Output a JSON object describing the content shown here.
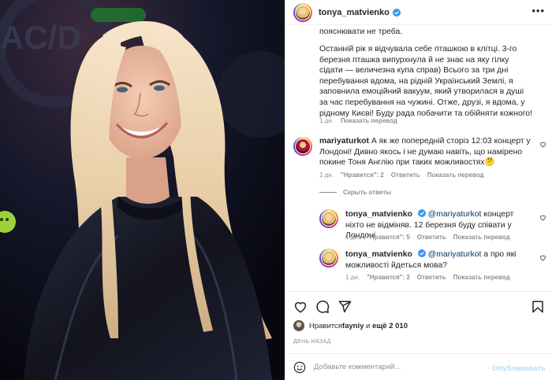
{
  "photo": {
    "alt_icon": "photo-woman-long-blonde-hair"
  },
  "header": {
    "username": "tonya_matvienko",
    "more_icon": "more-dots-icon"
  },
  "caption": {
    "line0": "пояснювати не треба.",
    "paragraph": "Останній рік я відчувала себе пташкою в клітці. 3-го березня пташка випурхнула й не знає на яку гілку сідати — величезна купа справ) Всього за три дні перебування вдома, на рідній Український Землі, я заповнила емоційний вакуум, який утворилася в душі за час перебування на чужині. Отже, друзі, я вдома, у рідному Києві! Буду рада побачити та обійняти кожного!",
    "time": "1 дн.",
    "translate": "Показать перевод"
  },
  "comments": [
    {
      "username": "mariyaturkot",
      "text": "А як же попередній сторіз 12:03 концерт у Лондоні! Дивно якось і не думаю навіть, що намірено покине Тоня Англію при таких можливостях🤔",
      "time": "1 дн.",
      "likes": "\"Нравится\": 2",
      "reply": "Ответить",
      "translate": "Показать перевод"
    }
  ],
  "hide_replies": "Скрыть ответы",
  "replies": [
    {
      "username": "tonya_matvienko",
      "mention": "@mariyaturkot",
      "text": " концерт ніхто не відміняв. 12 березня буду співати у Лондоні",
      "time": "1 дн.",
      "likes": "\"Нравится\": 5",
      "reply": "Ответить",
      "translate": "Показать перевод"
    },
    {
      "username": "tonya_matvienko",
      "mention": "@mariyaturkot",
      "text": " а про які можливості йдеться мова?",
      "time": "1 дн.",
      "likes": "\"Нравится\": 2",
      "reply": "Ответить",
      "translate": "Показать перевод"
    }
  ],
  "actions": {
    "like_icon": "heart-icon",
    "comment_icon": "comment-icon",
    "share_icon": "share-icon",
    "save_icon": "bookmark-icon"
  },
  "likes": {
    "prefix": "Нравится ",
    "user": "fayniy",
    "middle": " и ",
    "count": "ещё 2 010"
  },
  "date": "ДЕНЬ НАЗАД",
  "add_comment": {
    "placeholder": "Добавьте комментарий...",
    "publish": "Опубликовать"
  },
  "colors": {
    "verified": "#3897f0",
    "link": "#00376b",
    "publish_disabled": "#b2dffc",
    "muted": "#8e8e8e"
  }
}
